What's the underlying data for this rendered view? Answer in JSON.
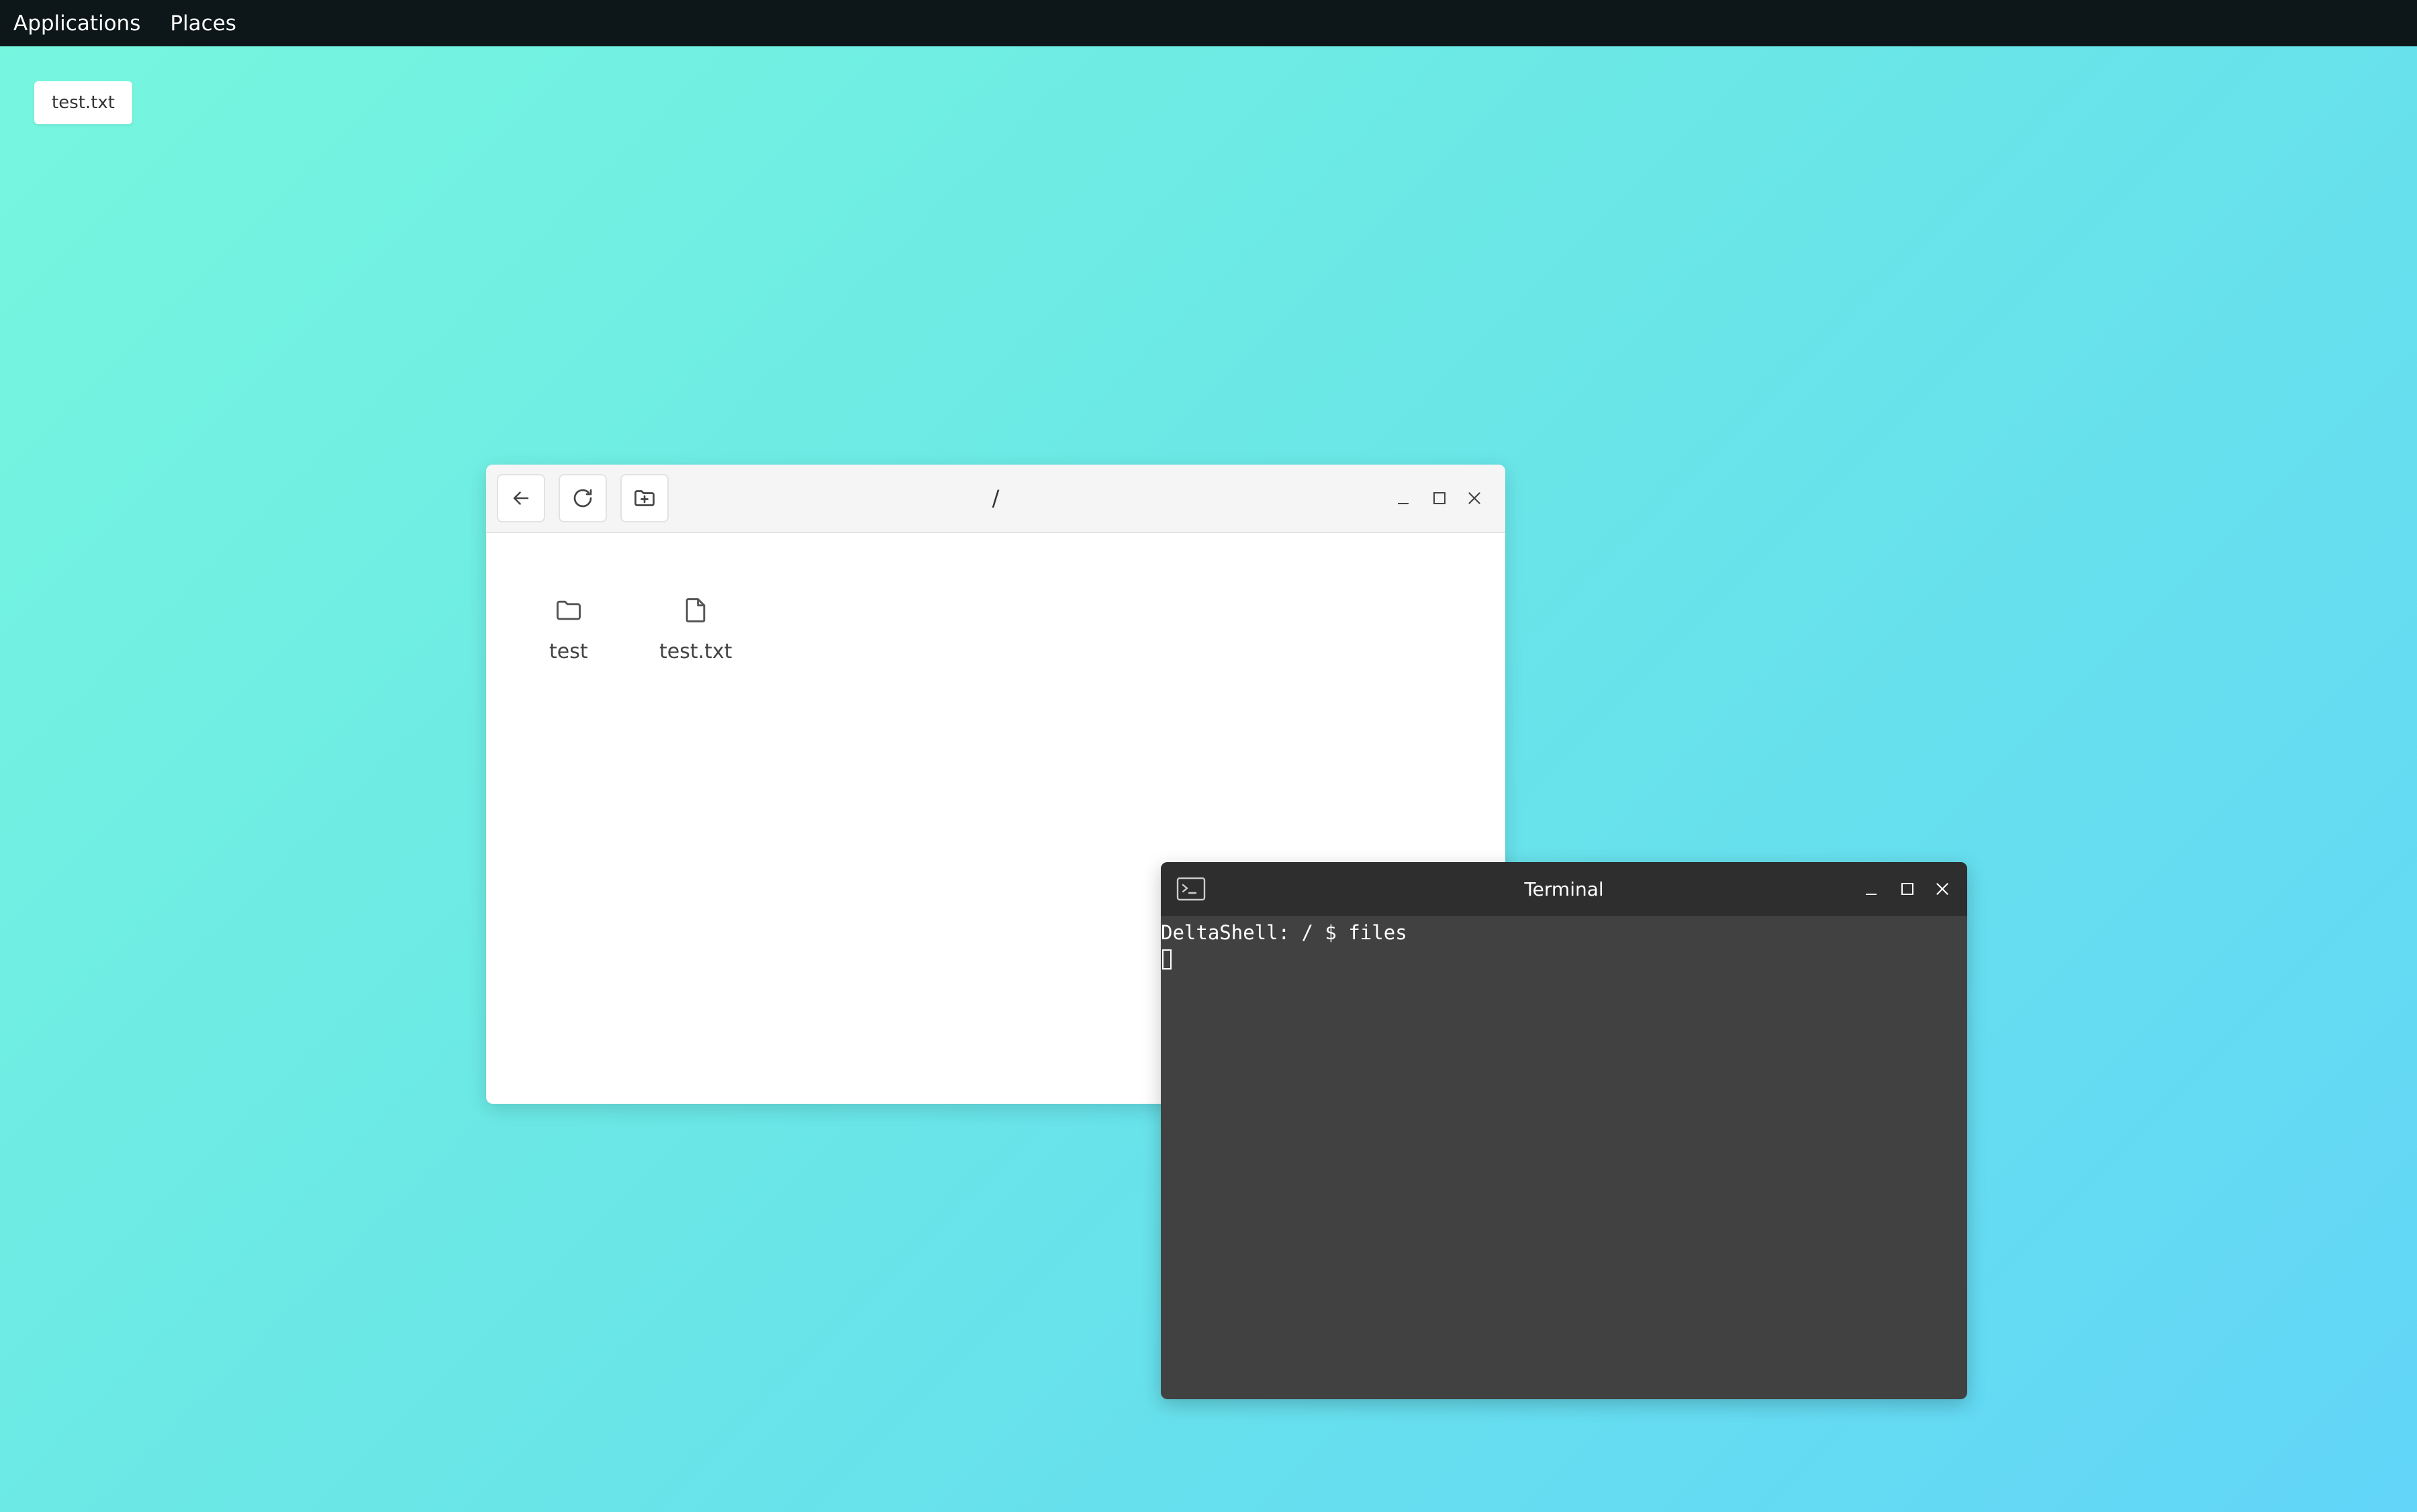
{
  "topbar": {
    "menu": [
      {
        "label": "Applications"
      },
      {
        "label": "Places"
      }
    ]
  },
  "desktop": {
    "chip_label": "test.txt"
  },
  "file_manager": {
    "path": "/",
    "toolbar_icons": [
      "back-arrow-icon",
      "refresh-icon",
      "new-folder-icon"
    ],
    "window_controls": [
      "minimize-icon",
      "maximize-icon",
      "close-icon"
    ],
    "items": [
      {
        "label": "test",
        "icon": "folder-icon"
      },
      {
        "label": "test.txt",
        "icon": "file-icon"
      }
    ]
  },
  "terminal": {
    "title": "Terminal",
    "icon": "terminal-icon",
    "prompt_line": "DeltaShell: / $ files",
    "window_controls": [
      "minimize-icon",
      "maximize-icon",
      "close-icon"
    ]
  },
  "colors": {
    "topbar_bg": "#0d1719",
    "terminal_bg": "#414141",
    "terminal_titlebar_bg": "#2e2e2e",
    "desktop_gradient_start": "#77f7df",
    "desktop_gradient_end": "#62d5f8"
  }
}
